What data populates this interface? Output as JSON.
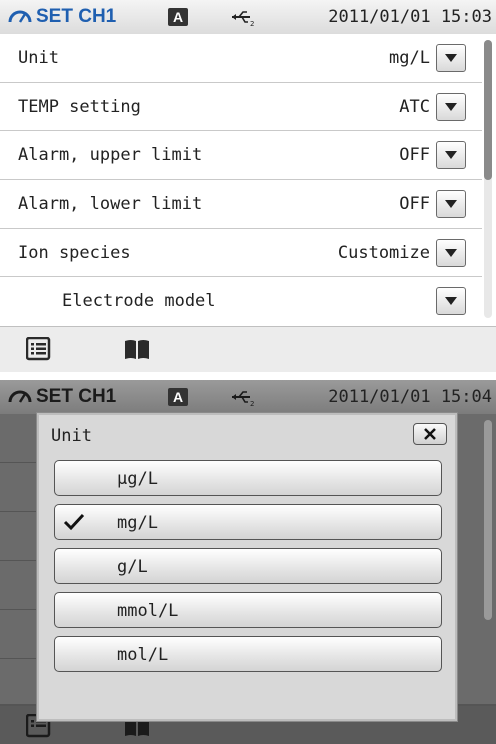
{
  "status_bar_top": {
    "title": "SET CH1",
    "mode_badge": "A",
    "datetime": "2011/01/01 15:03"
  },
  "settings": {
    "rows": [
      {
        "label": "Unit",
        "value": "mg/L"
      },
      {
        "label": "TEMP setting",
        "value": "ATC"
      },
      {
        "label": "Alarm, upper limit",
        "value": "OFF"
      },
      {
        "label": "Alarm, lower limit",
        "value": "OFF"
      },
      {
        "label": "Ion species",
        "value": "Customize"
      },
      {
        "label": "Electrode model",
        "value": ""
      }
    ]
  },
  "toolbar": {
    "icons": [
      "list-icon",
      "book-icon"
    ]
  },
  "status_bar_bottom": {
    "title": "SET CH1",
    "mode_badge": "A",
    "datetime": "2011/01/01 15:04"
  },
  "unit_dialog": {
    "title": "Unit",
    "selected": "mg/L",
    "options": [
      "μg/L",
      "mg/L",
      "g/L",
      "mmol/L",
      "mol/L"
    ]
  },
  "colors": {
    "title_blue": "#1f5fb0",
    "status_bar": "#e6e6e6",
    "dialog_bg": "#d8d8d8"
  }
}
